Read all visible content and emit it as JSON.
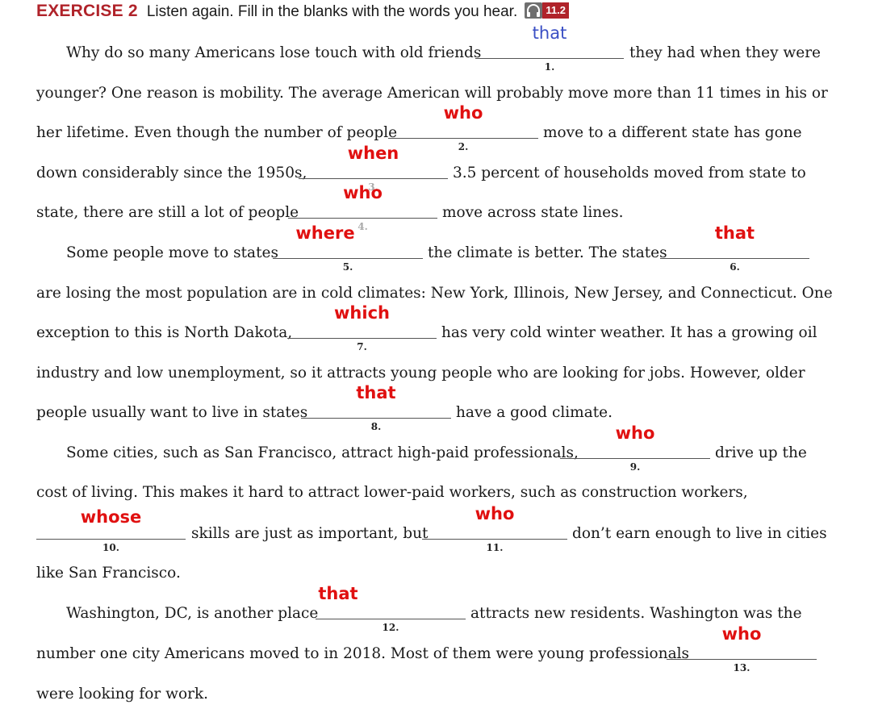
{
  "exercise": {
    "label": "EXERCISE 2",
    "instruction": "Listen again. Fill in the blanks with the words you hear.",
    "audio_icon": "headphones-icon",
    "track": "11.2"
  },
  "colors": {
    "accent": "#b0232a",
    "answer": "#e01010",
    "handwritten": "#3a4fc4"
  },
  "text": {
    "l1a": "Why do so many Americans lose touch with old friends",
    "l1b": "they had when they were",
    "l2": "younger? One reason is mobility. The average American will probably move more than 11 times in his or",
    "l3a": "her lifetime. Even though the number of people",
    "l3b": "move to a different state has gone",
    "l4a": "down considerably since the 1950s,",
    "l4b": "3.5 percent of households moved from state to",
    "l5a": "state, there are still a lot of people",
    "l5b": "move across state lines.",
    "l6a": "Some people move to states",
    "l6b": "the climate is better. The states",
    "l7": "are losing the most population are in cold climates: New York, Illinois, New Jersey, and Connecticut. One",
    "l8a": "exception to this is North Dakota,",
    "l8b": "has very cold winter weather. It has a growing oil",
    "l9": "industry and low unemployment, so it attracts young people who are looking for jobs. However, older",
    "l10a": "people usually want to live in states",
    "l10b": "have a good climate.",
    "l11a": "Some cities, such as San Francisco, attract high-paid professionals,",
    "l11b": "drive up the",
    "l12": "cost of living. This makes it hard to attract lower-paid workers, such as construction workers,",
    "l13a": "skills are just as important, but",
    "l13b": "don’t earn enough to live in cities",
    "l14": "like San Francisco.",
    "l15a": "Washington, DC, is another place",
    "l15b": "attracts new residents. Washington was the",
    "l16a": "number one city Americans moved to in 2018. Most of them were young professionals",
    "l17": "were looking for work."
  },
  "blanks": [
    {
      "num": "1.",
      "answer": "that"
    },
    {
      "num": "2.",
      "answer": "who"
    },
    {
      "num": "3.",
      "answer": "when"
    },
    {
      "num": "4.",
      "answer": "who"
    },
    {
      "num": "5.",
      "answer": "where"
    },
    {
      "num": "6.",
      "answer": "that"
    },
    {
      "num": "7.",
      "answer": "which"
    },
    {
      "num": "8.",
      "answer": "that"
    },
    {
      "num": "9.",
      "answer": "who"
    },
    {
      "num": "10.",
      "answer": "whose"
    },
    {
      "num": "11.",
      "answer": "who"
    },
    {
      "num": "12.",
      "answer": "that"
    },
    {
      "num": "13.",
      "answer": "who"
    }
  ]
}
